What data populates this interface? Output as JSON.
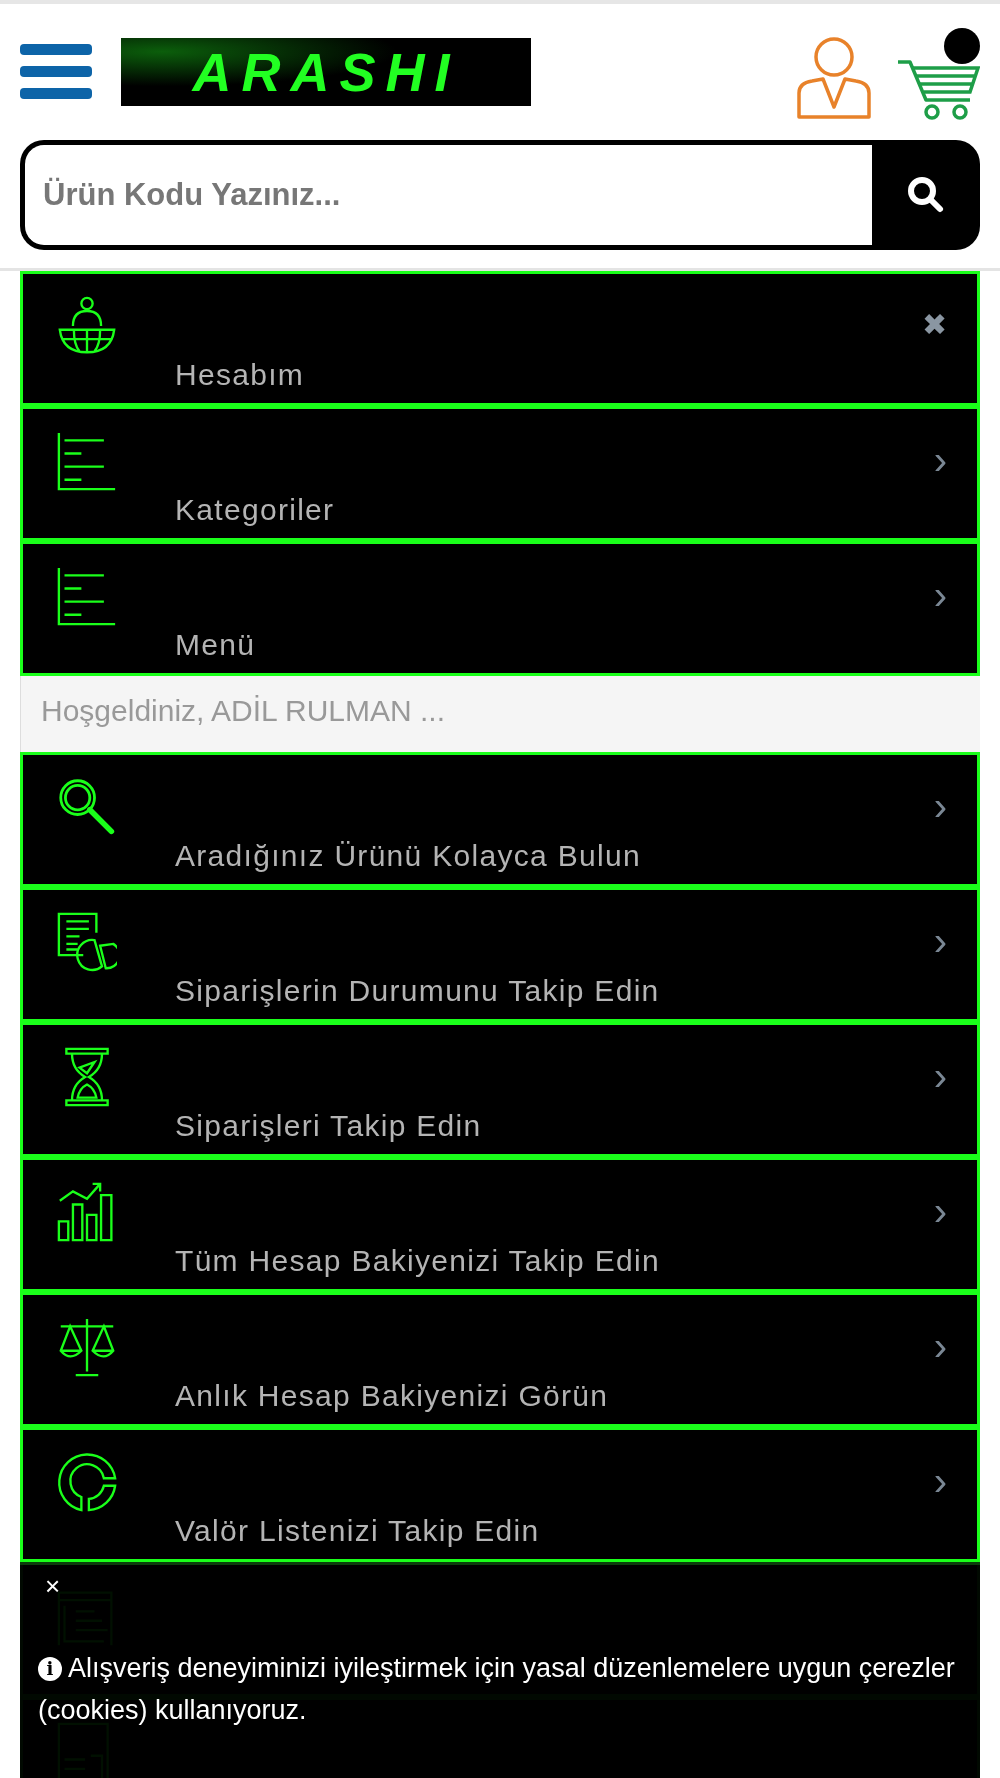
{
  "header": {
    "logo_text": "ARASHI",
    "cart_badge": true
  },
  "search": {
    "placeholder": "Ürün Kodu Yazınız..."
  },
  "menu": {
    "top_items": [
      {
        "label": "Hesabım",
        "kind": "close",
        "close_mark": "✖"
      },
      {
        "label": "Kategoriler",
        "kind": "link",
        "chevron": "›"
      },
      {
        "label": "Menü",
        "kind": "link",
        "chevron": "›"
      }
    ],
    "welcome": "Hoşgeldiniz, ADİL RULMAN ...",
    "items": [
      {
        "label": "Aradığınız Ürünü Kolayca Bulun",
        "chevron": "›"
      },
      {
        "label": "Siparişlerin Durumunu Takip Edin",
        "chevron": "›"
      },
      {
        "label": "Siparişleri Takip Edin",
        "chevron": "›"
      },
      {
        "label": "Tüm Hesap Bakiyenizi Takip Edin",
        "chevron": "›"
      },
      {
        "label": "Anlık Hesap Bakiyenizi Görün",
        "chevron": "›"
      },
      {
        "label": "Valör Listenizi Takip Edin",
        "chevron": "›"
      }
    ]
  },
  "cookie": {
    "close": "×",
    "info": "i",
    "text": "Alışveriş deneyiminizi iyileştirmek için yasal düzenlemelere uygun çerezler (cookies) kullanıyoruz."
  }
}
